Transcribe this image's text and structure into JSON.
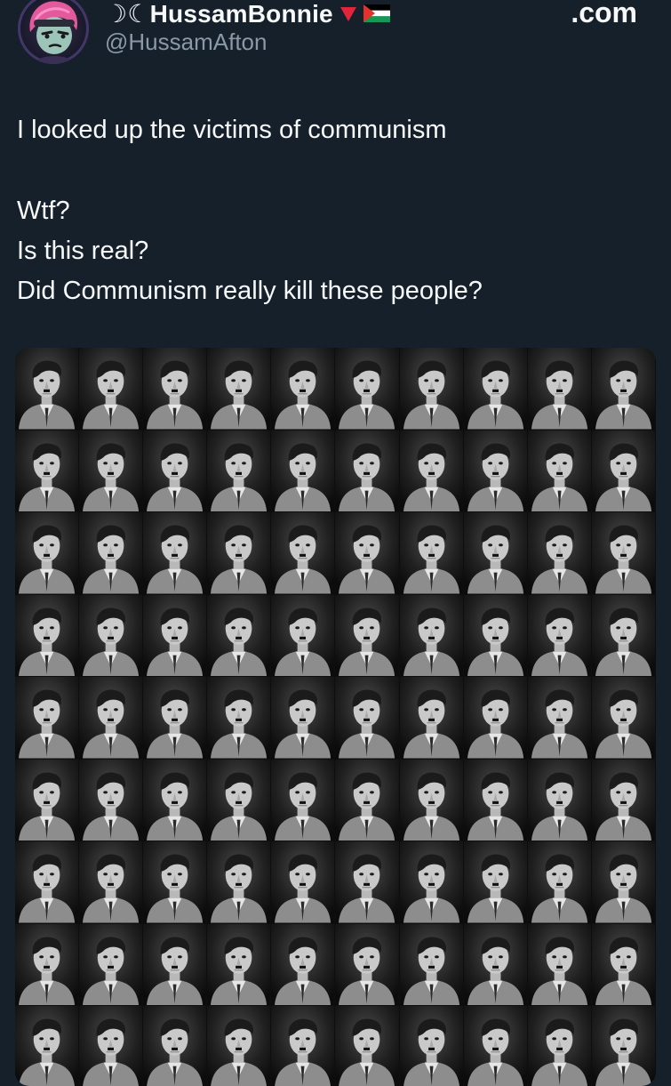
{
  "author": {
    "display_name": "☽☾HussamBonnie",
    "handle": "@HussamAfton",
    "avatar_icon": "cartoon-character-avatar-icon",
    "name_badges": [
      "red-triangle-icon",
      "palestine-flag-icon"
    ]
  },
  "overlay_text": ".com",
  "post": {
    "lines": [
      "I looked up the victims of communism",
      "Wtf?",
      "Is this real?",
      "Did Communism really kill these people?"
    ]
  },
  "media": {
    "kind": "photo-grid",
    "columns": 10,
    "rows": 9,
    "tile_icon": "repeated-portrait-photo",
    "colors": {
      "background": "#15202b",
      "text": "#f7f9f9",
      "secondary_text": "#8b98a5"
    }
  }
}
